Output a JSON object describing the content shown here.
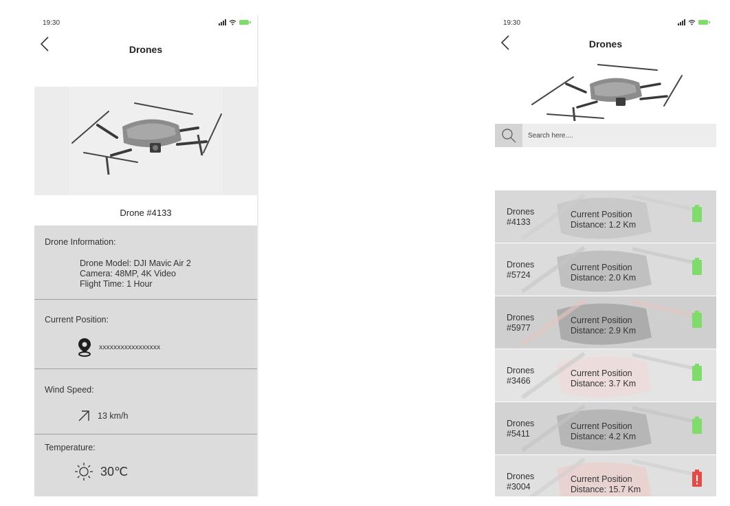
{
  "colors": {
    "battery_ok": "#7fdc6a",
    "battery_low": "#e24b47",
    "info_panel": "#dcdcdc",
    "divider": "#9f9f9f"
  },
  "detail_screen": {
    "status_time": "19:30",
    "title": "Drones",
    "drone_name": "Drone #4133",
    "info": {
      "heading": "Drone Information:",
      "model": "Drone Model: DJI Mavic Air 2",
      "camera": "Camera: 48MP, 4K Video",
      "flight_time": "Flight Time: 1 Hour"
    },
    "position": {
      "heading": "Current Position:",
      "value": "xxxxxxxxxxxxxxxxx",
      "icon": "map-pin-icon"
    },
    "wind": {
      "heading": "Wind Speed:",
      "value": "13 km/h",
      "icon": "arrow-up-right-icon"
    },
    "temperature": {
      "heading": "Temperature:",
      "value": "30℃",
      "icon": "sun-icon"
    }
  },
  "list_screen": {
    "status_time": "19:30",
    "title": "Drones",
    "search_placeholder": "Search here....",
    "items": [
      {
        "id_line1": "Drones",
        "id_line2": "#4133",
        "pos_label": "Current Position",
        "distance": "Distance: 1.2 Km",
        "battery": "ok"
      },
      {
        "id_line1": "Drones",
        "id_line2": "#5724",
        "pos_label": "Current Position",
        "distance": "Distance: 2.0 Km",
        "battery": "ok"
      },
      {
        "id_line1": "Drones",
        "id_line2": "#5977",
        "pos_label": "Current Position",
        "distance": "Distance: 2.9 Km",
        "battery": "ok"
      },
      {
        "id_line1": "Drones",
        "id_line2": "#3466",
        "pos_label": "Current Position",
        "distance": "Distance: 3.7 Km",
        "battery": "ok"
      },
      {
        "id_line1": "Drones",
        "id_line2": "#5411",
        "pos_label": "Current Position",
        "distance": "Distance: 4.2 Km",
        "battery": "ok"
      },
      {
        "id_line1": "Drones",
        "id_line2": "#3004",
        "pos_label": "Current Position",
        "distance": "Distance: 15.7 Km",
        "battery": "low"
      }
    ]
  }
}
